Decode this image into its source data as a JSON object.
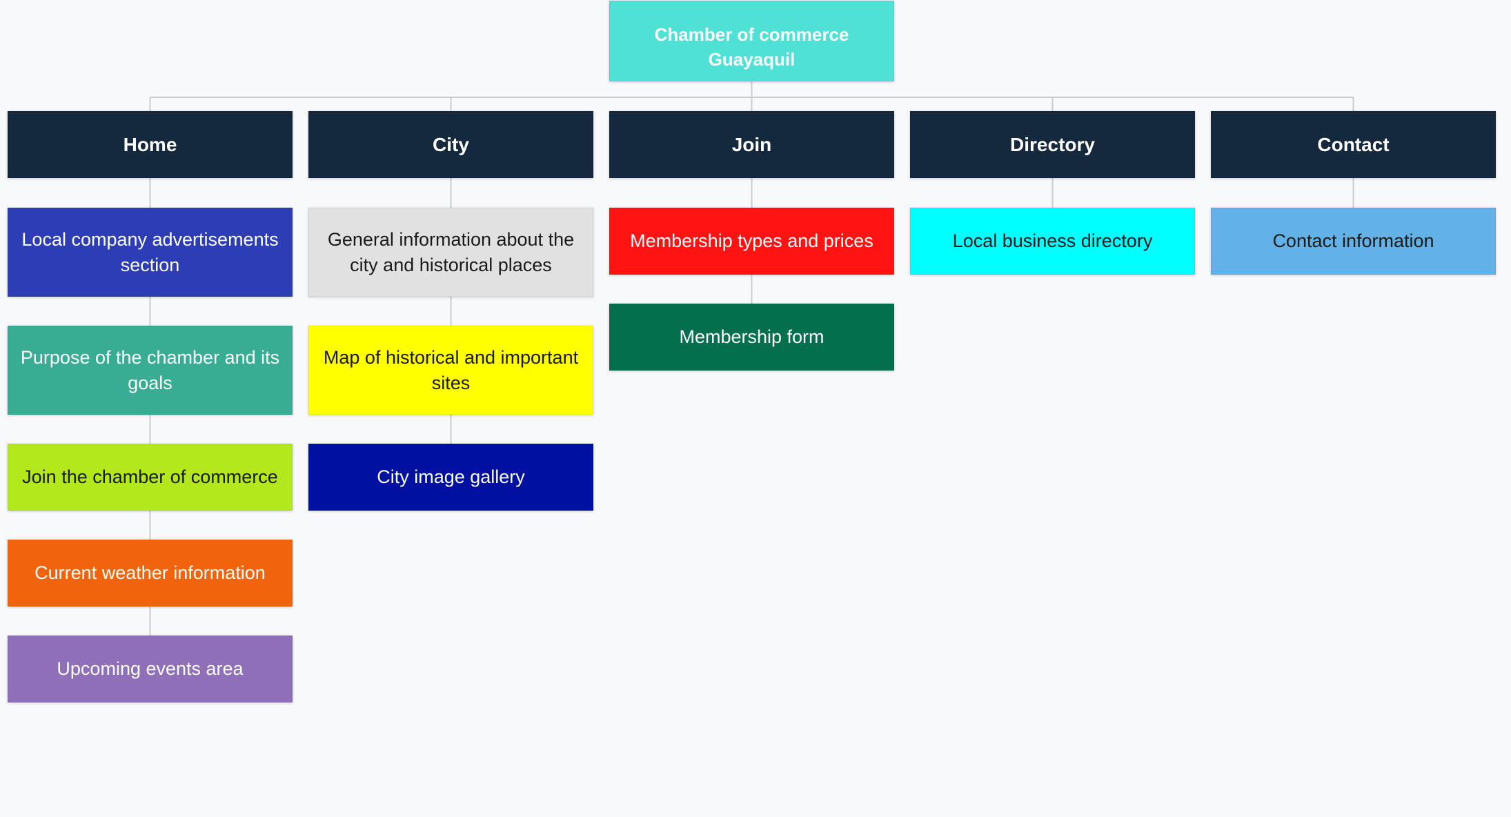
{
  "root": {
    "label": "Chamber of commerce Guayaquil",
    "color": "#4fe0d6",
    "text_color": "#ffffff"
  },
  "categories": [
    {
      "label": "Home",
      "color": "#15293e",
      "text_color": "#ffffff",
      "children": [
        {
          "label": "Local company advertisements section",
          "color": "#2c3db5",
          "text_color": "#ffffff"
        },
        {
          "label": "Purpose of the chamber and its goals",
          "color": "#38ad93",
          "text_color": "#ffffff"
        },
        {
          "label": "Join the chamber of commerce",
          "color": "#b2e81c",
          "text_color": "#1a1a1a"
        },
        {
          "label": "Current weather information",
          "color": "#f2640b",
          "text_color": "#ffffff"
        },
        {
          "label": "Upcoming events area",
          "color": "#8e6fb8",
          "text_color": "#ffffff"
        }
      ]
    },
    {
      "label": "City",
      "color": "#15293e",
      "text_color": "#ffffff",
      "children": [
        {
          "label": "General information about the city and historical places",
          "color": "#e1e1e1",
          "text_color": "#1a1a1a"
        },
        {
          "label": "Map of historical and important sites",
          "color": "#ffff00",
          "text_color": "#1a1a1a"
        },
        {
          "label": "City image gallery",
          "color": "#0011a1",
          "text_color": "#ffffff"
        }
      ]
    },
    {
      "label": "Join",
      "color": "#15293e",
      "text_color": "#ffffff",
      "children": [
        {
          "label": "Membership types and prices",
          "color": "#ff1313",
          "text_color": "#ffffff"
        },
        {
          "label": "Membership form",
          "color": "#046f4c",
          "text_color": "#ffffff"
        }
      ]
    },
    {
      "label": "Directory",
      "color": "#15293e",
      "text_color": "#ffffff",
      "children": [
        {
          "label": "Local business directory",
          "color": "#00ffff",
          "text_color": "#1a1a1a"
        }
      ]
    },
    {
      "label": "Contact",
      "color": "#15293e",
      "text_color": "#ffffff",
      "children": [
        {
          "label": "Contact information",
          "color": "#62b2e8",
          "text_color": "#1a1a1a"
        }
      ]
    }
  ]
}
